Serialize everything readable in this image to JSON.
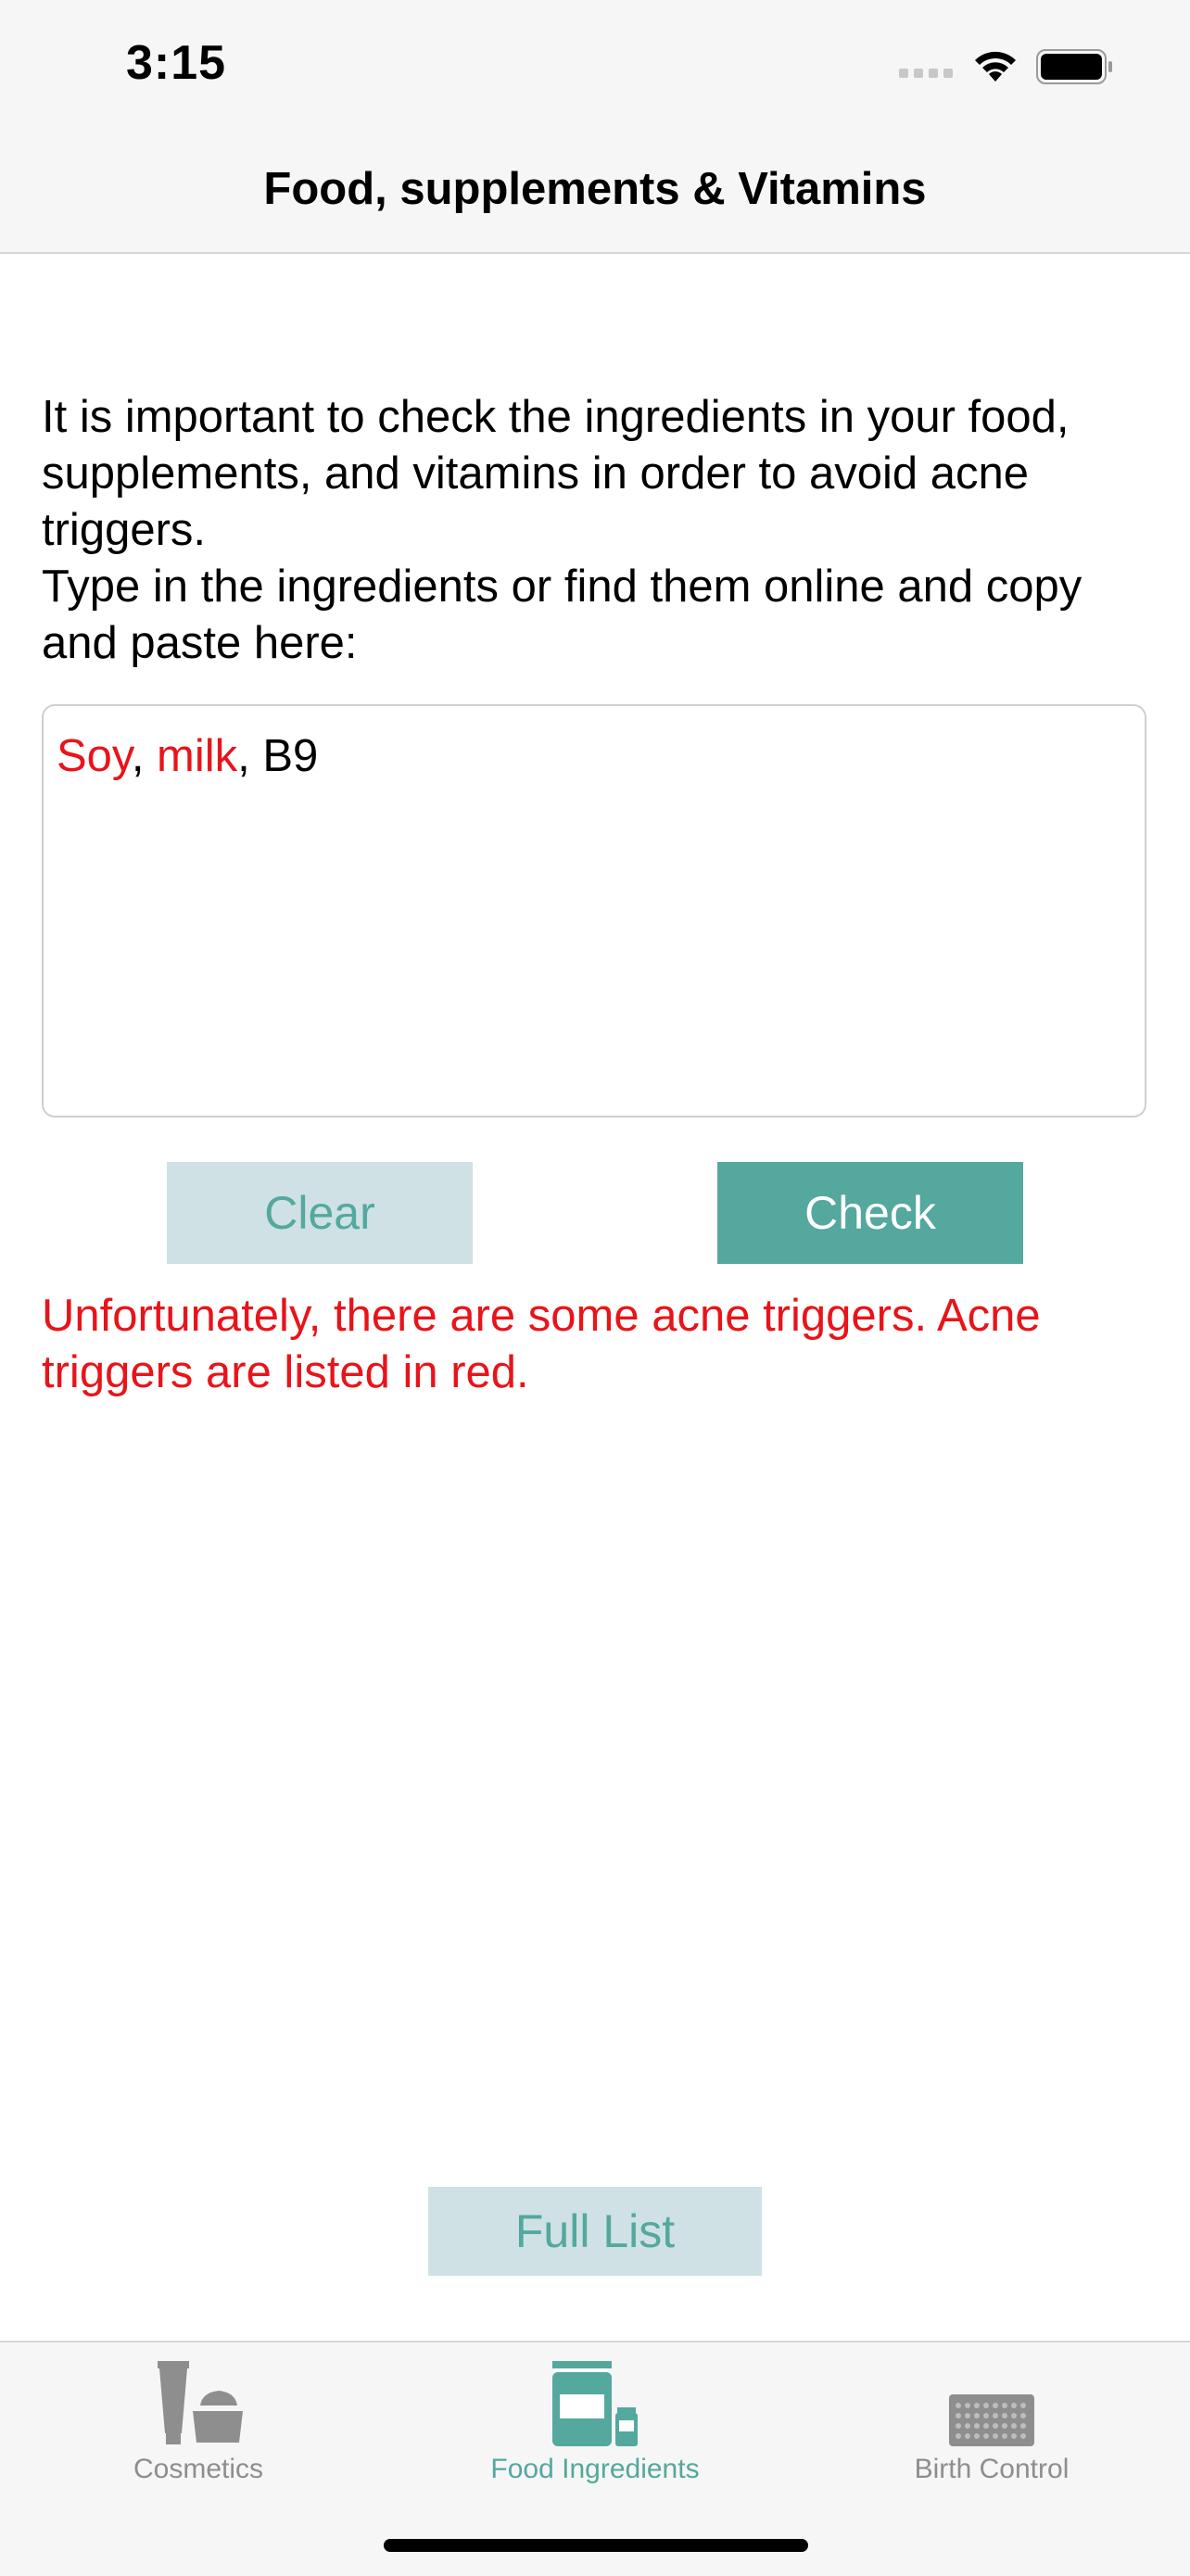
{
  "status_bar": {
    "time": "3:15"
  },
  "nav": {
    "title": "Food, supplements & Vitamins"
  },
  "intro": {
    "line1": "It is important to check the ingredients in your food, supplements, and vitamins in order to avoid acne triggers.",
    "line2": "Type in the ingredients or find them online and copy and paste here:"
  },
  "ingredients_input": {
    "tokens": [
      {
        "text": "Soy",
        "trigger": true
      },
      {
        "text": ", ",
        "trigger": false
      },
      {
        "text": "milk",
        "trigger": true
      },
      {
        "text": ", B9",
        "trigger": false
      }
    ]
  },
  "buttons": {
    "clear": "Clear",
    "check": "Check",
    "full_list": "Full List"
  },
  "result": {
    "message": "Unfortunately, there are some acne triggers. Acne triggers are listed in red."
  },
  "tabs": [
    {
      "label": "Cosmetics",
      "icon": "cosmetics-icon",
      "active": false
    },
    {
      "label": "Food Ingredients",
      "icon": "food-jar-icon",
      "active": true
    },
    {
      "label": "Birth Control",
      "icon": "pill-pack-icon",
      "active": false
    }
  ],
  "colors": {
    "accent": "#54a89d",
    "accent_light": "#cfe1e5",
    "trigger_red": "#e8141a",
    "inactive_gray": "#8e8e8e"
  }
}
